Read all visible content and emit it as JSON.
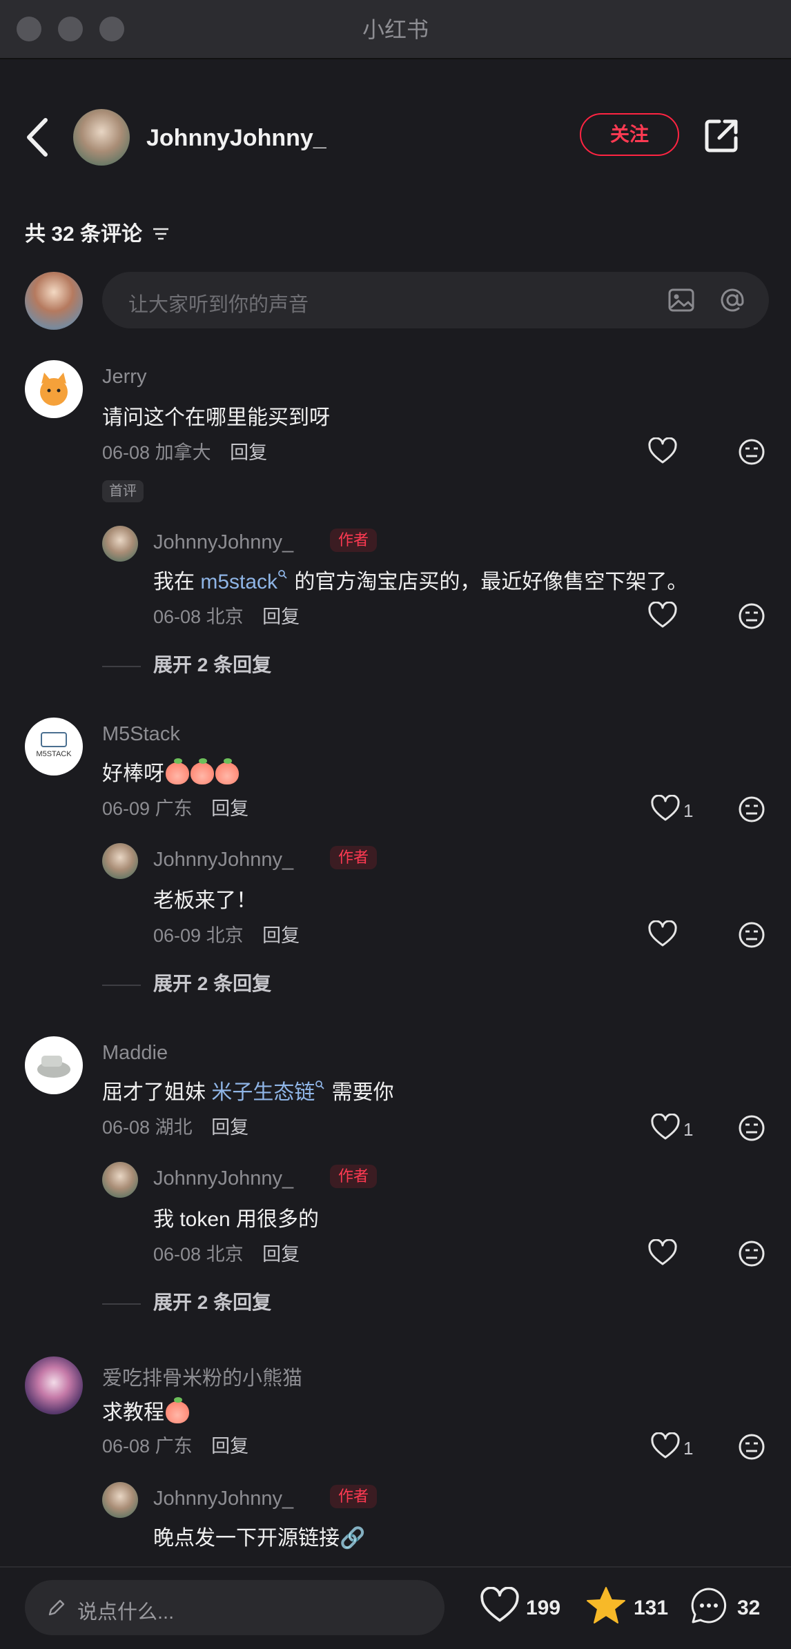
{
  "window": {
    "title": "小红书"
  },
  "header": {
    "author_name": "JohnnyJohnny_",
    "follow_label": "关注"
  },
  "comments_header": {
    "count_text": "共 32 条评论"
  },
  "comment_input": {
    "placeholder": "让大家听到你的声音"
  },
  "comments": [
    {
      "name": "Jerry",
      "text": "请问这个在哪里能买到呀",
      "date": "06-08",
      "location": "加拿大",
      "reply_label": "回复",
      "badge": "首评",
      "reply": {
        "name": "JohnnyJohnny_",
        "badge": "作者",
        "text_before": "我在 ",
        "link": "m5stack",
        "text_after": " 的官方淘宝店买的，最近好像售空下架了。",
        "date": "06-08",
        "location": "北京",
        "reply_label": "回复"
      },
      "expand_label": "展开 2 条回复"
    },
    {
      "name": "M5Stack",
      "text": "好棒呀",
      "date": "06-09",
      "location": "广东",
      "reply_label": "回复",
      "likes": "1",
      "reply": {
        "name": "JohnnyJohnny_",
        "badge": "作者",
        "text": "老板来了！",
        "date": "06-09",
        "location": "北京",
        "reply_label": "回复"
      },
      "expand_label": "展开 2 条回复"
    },
    {
      "name": "Maddie",
      "text_before": "屈才了姐妹 ",
      "link": "米子生态链",
      "text_after": " 需要你",
      "date": "06-08",
      "location": "湖北",
      "reply_label": "回复",
      "likes": "1",
      "reply": {
        "name": "JohnnyJohnny_",
        "badge": "作者",
        "text": "我 token 用很多的",
        "date": "06-08",
        "location": "北京",
        "reply_label": "回复"
      },
      "expand_label": "展开 2 条回复"
    },
    {
      "name": "爱吃排骨米粉的小熊猫",
      "text": "求教程",
      "date": "06-08",
      "location": "广东",
      "reply_label": "回复",
      "likes": "1",
      "reply": {
        "name": "JohnnyJohnny_",
        "badge": "作者",
        "text": "晚点发一下开源链接🔗"
      }
    }
  ],
  "bottom_bar": {
    "placeholder": "说点什么...",
    "likes": "199",
    "stars": "131",
    "comments": "32"
  },
  "colors": {
    "accent": "#ff2442",
    "background": "#1b1b1f",
    "link": "#8fb5e6"
  },
  "icons": [
    "back-icon",
    "share-icon",
    "filter-icon",
    "image-icon",
    "at-icon",
    "heart-icon",
    "dislike-icon",
    "pen-icon",
    "star-icon",
    "comment-icon"
  ]
}
